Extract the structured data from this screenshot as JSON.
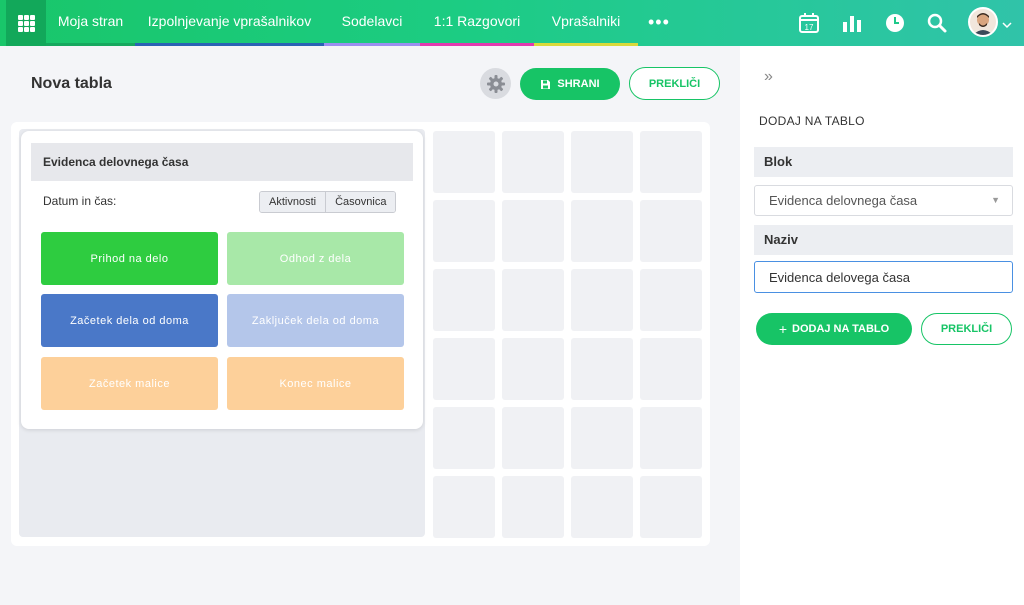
{
  "nav": {
    "items": [
      {
        "label": "Moja stran",
        "color": "#16a85e"
      },
      {
        "label": "Izpolnjevanje vprašalnikov",
        "color": "#2a62b4"
      },
      {
        "label": "Sodelavci",
        "color": "#9b8ef0"
      },
      {
        "label": "1:1 Razgovori",
        "color": "#e23ab0"
      },
      {
        "label": "Vprašalniki",
        "color": "#d9d93a"
      }
    ],
    "more_label": "•••",
    "calendar_day": "17",
    "icons": [
      "apps-grid-icon",
      "calendar-icon",
      "bar-chart-icon",
      "clock-icon",
      "search-icon",
      "avatar",
      "chevron-down-icon"
    ]
  },
  "board": {
    "title": "Nova tabla",
    "save_label": "SHRANI",
    "cancel_label": "PREKLIČI",
    "widget": {
      "header": "Evidenca delovnega časa",
      "datetime_label": "Datum in čas:",
      "segments": [
        "Aktivnosti",
        "Časovnica"
      ],
      "tiles": [
        {
          "label": "Prihod na delo",
          "color": "#2ecc40"
        },
        {
          "label": "Odhod z dela",
          "color": "#a8e8a8"
        },
        {
          "label": "Začetek dela od doma",
          "color": "#4a78c8"
        },
        {
          "label": "Zaključek dela od doma",
          "color": "#b4c6ea"
        },
        {
          "label": "Začetek malice",
          "color": "#fdd09a"
        },
        {
          "label": "Konec malice",
          "color": "#fdd09a"
        }
      ]
    }
  },
  "panel": {
    "collapse_icon": "»",
    "title": "DODAJ NA TABLO",
    "block_label": "Blok",
    "block_value": "Evidenca delovnega časa",
    "name_label": "Naziv",
    "name_value": "Evidenca delovega časa",
    "add_label": "DODAJ NA TABLO",
    "cancel_label": "PREKLIČI"
  },
  "colors": {
    "accent": "#17c466"
  }
}
